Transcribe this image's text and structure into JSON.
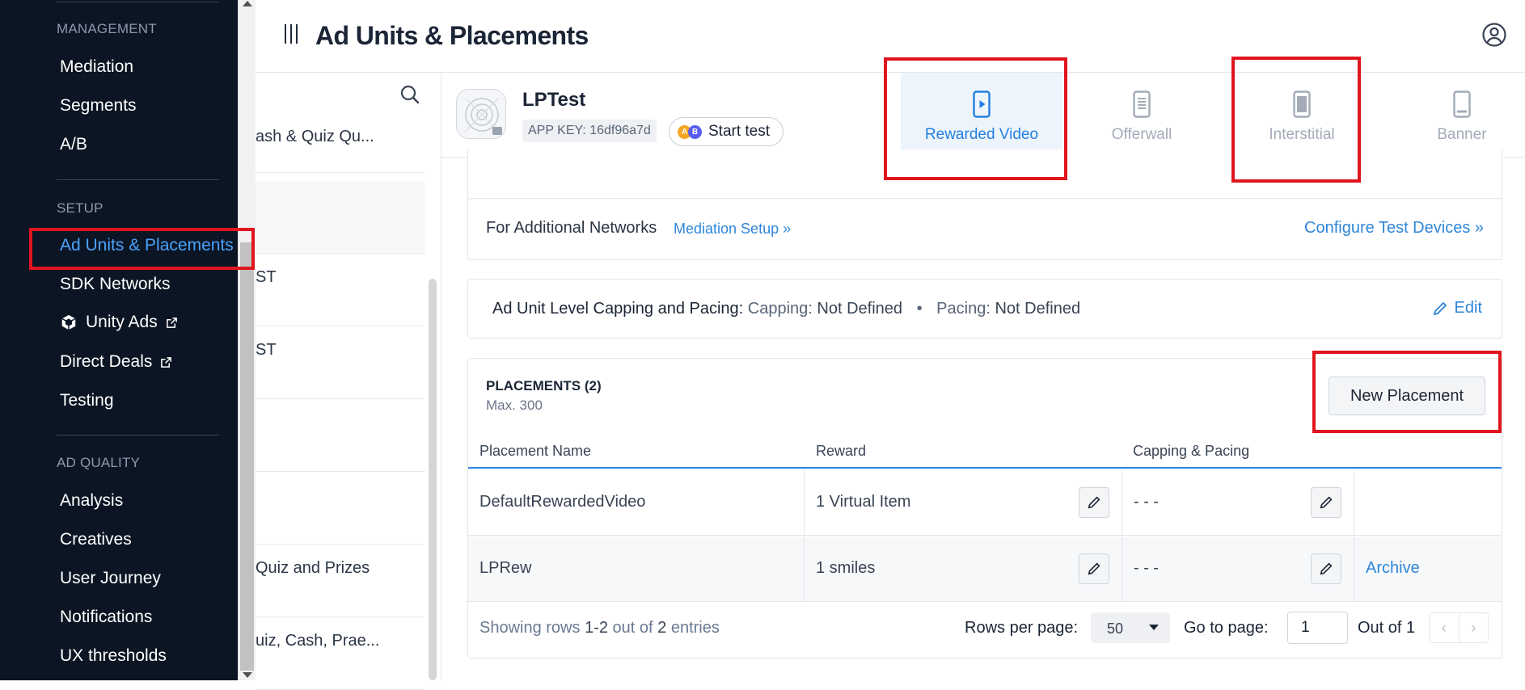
{
  "sidenav": {
    "sections": {
      "management": "MANAGEMENT",
      "setup": "SETUP",
      "ad_quality": "AD QUALITY"
    },
    "items": {
      "mediation": "Mediation",
      "segments": "Segments",
      "ab": "A/B",
      "ad_units": "Ad Units & Placements",
      "sdk_networks": "SDK Networks",
      "unity_ads": "Unity Ads",
      "direct_deals": "Direct Deals",
      "testing": "Testing",
      "analysis": "Analysis",
      "creatives": "Creatives",
      "user_journey": "User Journey",
      "notifications": "Notifications",
      "ux_thresholds": "UX thresholds"
    },
    "active_item": "Ad Units & Placements"
  },
  "header": {
    "title": "Ad Units & Placements"
  },
  "app_list": {
    "rows": [
      "ash & Quiz Qu...",
      "",
      "ST",
      "ST",
      "",
      "",
      "Quiz and Prizes",
      "uiz, Cash, Prae..."
    ]
  },
  "app": {
    "name": "LPTest",
    "app_key": "APP KEY: 16df96a7d",
    "start_test": "Start test",
    "ab_a": "A",
    "ab_b": "B"
  },
  "ad_tabs": {
    "rewarded_video": "Rewarded Video",
    "offerwall": "Offerwall",
    "interstitial": "Interstitial",
    "banner": "Banner",
    "active": "Rewarded Video"
  },
  "networks": {
    "label": "For Additional Networks",
    "mediation_setup": "Mediation Setup »",
    "configure_devices": "Configure Test Devices »"
  },
  "capping": {
    "label": "Ad Unit Level Capping and Pacing:",
    "capping_label": "Capping:",
    "capping_value": "Not Defined",
    "separator": "•",
    "pacing_label": "Pacing:",
    "pacing_value": "Not Defined",
    "edit": "Edit"
  },
  "placements": {
    "title": "PLACEMENTS (2)",
    "max": "Max. 300",
    "new_button": "New Placement",
    "columns": {
      "name": "Placement Name",
      "reward": "Reward",
      "capping": "Capping & Pacing"
    },
    "rows": [
      {
        "name": "DefaultRewardedVideo",
        "reward": "1 Virtual Item",
        "capping": "- - -",
        "action": ""
      },
      {
        "name": "LPRew",
        "reward": "1 smiles",
        "capping": "- - -",
        "action": "Archive"
      }
    ],
    "footer": {
      "showing_prefix": "Showing rows",
      "range": "1-2",
      "out_of": "out of",
      "total": "2",
      "entries": "entries",
      "rows_per_page_label": "Rows per page:",
      "rows_per_page_value": "50",
      "go_to_page_label": "Go to page:",
      "go_to_page_value": "1",
      "out_of_pages": "Out of 1",
      "prev": "‹",
      "next": "›"
    }
  },
  "colors": {
    "sidenav_bg": "#0b1523",
    "accent": "#2b86e3",
    "link": "#2f86d9",
    "highlight": "#e0151f"
  }
}
